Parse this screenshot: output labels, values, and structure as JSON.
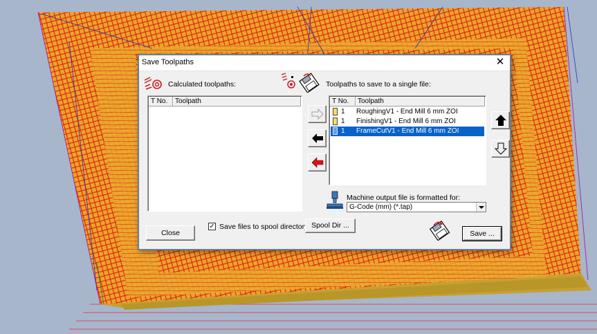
{
  "dialog": {
    "title": "Save Toolpaths",
    "close_glyph": "✕",
    "calculated_label": "Calculated toolpaths:",
    "save_single_label": "Toolpaths to save to a single file:",
    "left_list": {
      "columns": [
        "T No.",
        "Toolpath"
      ],
      "rows": []
    },
    "right_list": {
      "columns": [
        "T No.",
        "Toolpath"
      ],
      "rows": [
        {
          "tno": "1",
          "toolpath": "RoughingV1 - End Mill 6 mm ZOI",
          "selected": false
        },
        {
          "tno": "1",
          "toolpath": "FinishingV1 - End Mill 6 mm ZOI",
          "selected": false
        },
        {
          "tno": "1",
          "toolpath": "FrameCutV1 - End Mill 6 mm ZOI",
          "selected": true
        }
      ]
    },
    "machine_output_label": "Machine output file is formatted for:",
    "post_processor": {
      "selected": "G-Code (mm) (*.tap)"
    },
    "close_button": "Close",
    "spool_checkbox": {
      "label": "Save files to spool directory",
      "checked": true,
      "glyph": "✓"
    },
    "spool_dir_button": "Spool Dir ...",
    "save_button": "Save ..."
  },
  "icons": {
    "calculated": "toolpaths-icon",
    "add_to_file": "toolpath-to-disk-icon",
    "move_right": "arrow-right-icon",
    "move_left": "arrow-left-icon",
    "remove_all": "red-arrow-left-icon",
    "move_up": "arrow-up-icon",
    "move_down": "arrow-down-icon",
    "machine": "machine-icon",
    "save": "save-disk-icon"
  },
  "colors": {
    "selection": "#0a62c9",
    "wire_red": "#e01010",
    "wire_yellow": "#e8b020"
  }
}
